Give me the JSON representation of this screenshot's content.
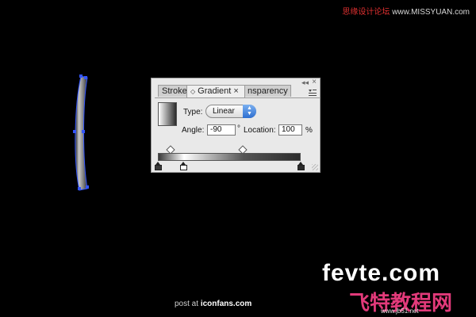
{
  "watermark_top": {
    "text": "思缘设计论坛",
    "url": "www.MISSYUAN.com"
  },
  "panel": {
    "tabs": [
      {
        "label": "Stroke"
      },
      {
        "label": "Gradient",
        "close": "×",
        "arrows": "◇"
      },
      {
        "label": "nsparency"
      }
    ],
    "close": "×",
    "collapse": "◂◂",
    "type_label": "Type:",
    "type_value": "Linear",
    "angle_label": "Angle:",
    "angle_value": "-90",
    "degree_symbol": "°",
    "location_label": "Location:",
    "location_value": "100",
    "percent": "%"
  },
  "footer": {
    "post_at": "post at",
    "site": "iconfans.com"
  },
  "logo": {
    "main": "fevte.com",
    "sub": "飞特教程网",
    "url": "www.jb51.net"
  },
  "colors": {
    "accent_blue": "#2e6fd0",
    "panel_bg": "#e9e9e9",
    "logo_pink": "#e23a7a",
    "selection_blue": "#3355ff"
  }
}
